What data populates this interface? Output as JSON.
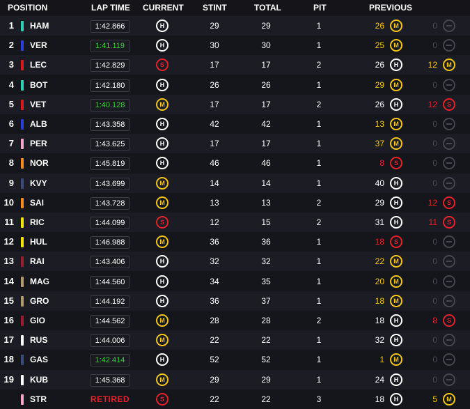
{
  "header": {
    "position": "POSITION",
    "lap_time": "LAP TIME",
    "current": "CURRENT",
    "stint": "STINT",
    "total": "TOTAL",
    "pit": "PIT",
    "previous": "PREVIOUS"
  },
  "colors": {
    "fastest": "#3ad03a",
    "previous_yellow": "#f5c518",
    "previous_red": "#e8212a",
    "previous_white": "#ffffff",
    "previous_dim": "#444650"
  },
  "rows": [
    {
      "pos": "1",
      "code": "HAM",
      "team": "#2fd1b5",
      "lap": "1:42.866",
      "fast": false,
      "cur": "H",
      "stint": "29",
      "total": "29",
      "pit": "1",
      "p1": "26",
      "p1c": "M",
      "p2": "0",
      "p2c": "none"
    },
    {
      "pos": "2",
      "code": "VER",
      "team": "#2a3ed9",
      "lap": "1:41.119",
      "fast": true,
      "cur": "H",
      "stint": "30",
      "total": "30",
      "pit": "1",
      "p1": "25",
      "p1c": "M",
      "p2": "0",
      "p2c": "none"
    },
    {
      "pos": "3",
      "code": "LEC",
      "team": "#d71920",
      "lap": "1:42.829",
      "fast": false,
      "cur": "S",
      "stint": "17",
      "total": "17",
      "pit": "2",
      "p1": "26",
      "p1c": "H",
      "p2": "12",
      "p2c": "M"
    },
    {
      "pos": "4",
      "code": "BOT",
      "team": "#2fd1b5",
      "lap": "1:42.180",
      "fast": false,
      "cur": "H",
      "stint": "26",
      "total": "26",
      "pit": "1",
      "p1": "29",
      "p1c": "M",
      "p2": "0",
      "p2c": "none"
    },
    {
      "pos": "5",
      "code": "VET",
      "team": "#d71920",
      "lap": "1:40.128",
      "fast": true,
      "cur": "M",
      "stint": "17",
      "total": "17",
      "pit": "2",
      "p1": "26",
      "p1c": "H",
      "p2": "12",
      "p2c": "S"
    },
    {
      "pos": "6",
      "code": "ALB",
      "team": "#2a3ed9",
      "lap": "1:43.358",
      "fast": false,
      "cur": "H",
      "stint": "42",
      "total": "42",
      "pit": "1",
      "p1": "13",
      "p1c": "M",
      "p2": "0",
      "p2c": "none"
    },
    {
      "pos": "7",
      "code": "PER",
      "team": "#f4a6c8",
      "lap": "1:43.625",
      "fast": false,
      "cur": "H",
      "stint": "17",
      "total": "17",
      "pit": "1",
      "p1": "37",
      "p1c": "M",
      "p2": "0",
      "p2c": "none"
    },
    {
      "pos": "8",
      "code": "NOR",
      "team": "#f58a1f",
      "lap": "1:45.819",
      "fast": false,
      "cur": "H",
      "stint": "46",
      "total": "46",
      "pit": "1",
      "p1": "8",
      "p1c": "S",
      "p2": "0",
      "p2c": "none"
    },
    {
      "pos": "9",
      "code": "KVY",
      "team": "#3a4a7a",
      "lap": "1:43.699",
      "fast": false,
      "cur": "M",
      "stint": "14",
      "total": "14",
      "pit": "1",
      "p1": "40",
      "p1c": "H",
      "p2": "0",
      "p2c": "none"
    },
    {
      "pos": "10",
      "code": "SAI",
      "team": "#f58a1f",
      "lap": "1:43.728",
      "fast": false,
      "cur": "M",
      "stint": "13",
      "total": "13",
      "pit": "2",
      "p1": "29",
      "p1c": "H",
      "p2": "12",
      "p2c": "S"
    },
    {
      "pos": "11",
      "code": "RIC",
      "team": "#f2e400",
      "lap": "1:44.099",
      "fast": false,
      "cur": "S",
      "stint": "12",
      "total": "15",
      "pit": "2",
      "p1": "31",
      "p1c": "H",
      "p2": "11",
      "p2c": "S"
    },
    {
      "pos": "12",
      "code": "HUL",
      "team": "#f2e400",
      "lap": "1:46.988",
      "fast": false,
      "cur": "M",
      "stint": "36",
      "total": "36",
      "pit": "1",
      "p1": "18",
      "p1c": "S",
      "p2": "0",
      "p2c": "none"
    },
    {
      "pos": "13",
      "code": "RAI",
      "team": "#9b1b2f",
      "lap": "1:43.406",
      "fast": false,
      "cur": "H",
      "stint": "32",
      "total": "32",
      "pit": "1",
      "p1": "22",
      "p1c": "M",
      "p2": "0",
      "p2c": "none"
    },
    {
      "pos": "14",
      "code": "MAG",
      "team": "#b39a6a",
      "lap": "1:44.560",
      "fast": false,
      "cur": "H",
      "stint": "34",
      "total": "35",
      "pit": "1",
      "p1": "20",
      "p1c": "M",
      "p2": "0",
      "p2c": "none"
    },
    {
      "pos": "15",
      "code": "GRO",
      "team": "#b39a6a",
      "lap": "1:44.192",
      "fast": false,
      "cur": "H",
      "stint": "36",
      "total": "37",
      "pit": "1",
      "p1": "18",
      "p1c": "M",
      "p2": "0",
      "p2c": "none"
    },
    {
      "pos": "16",
      "code": "GIO",
      "team": "#9b1b2f",
      "lap": "1:44.562",
      "fast": false,
      "cur": "M",
      "stint": "28",
      "total": "28",
      "pit": "2",
      "p1": "18",
      "p1c": "H",
      "p2": "8",
      "p2c": "S"
    },
    {
      "pos": "17",
      "code": "RUS",
      "team": "#ffffff",
      "lap": "1:44.006",
      "fast": false,
      "cur": "M",
      "stint": "22",
      "total": "22",
      "pit": "1",
      "p1": "32",
      "p1c": "H",
      "p2": "0",
      "p2c": "none"
    },
    {
      "pos": "18",
      "code": "GAS",
      "team": "#3a4a7a",
      "lap": "1:42.414",
      "fast": true,
      "cur": "H",
      "stint": "52",
      "total": "52",
      "pit": "1",
      "p1": "1",
      "p1c": "M",
      "p2": "0",
      "p2c": "none"
    },
    {
      "pos": "19",
      "code": "KUB",
      "team": "#ffffff",
      "lap": "1:45.368",
      "fast": false,
      "cur": "M",
      "stint": "29",
      "total": "29",
      "pit": "1",
      "p1": "24",
      "p1c": "H",
      "p2": "0",
      "p2c": "none"
    },
    {
      "pos": "",
      "code": "STR",
      "team": "#f4a6c8",
      "lap": "RETIRED",
      "fast": false,
      "retired": true,
      "cur": "S",
      "stint": "22",
      "total": "22",
      "pit": "3",
      "p1": "18",
      "p1c": "H",
      "p2": "5",
      "p2c": "M"
    }
  ]
}
